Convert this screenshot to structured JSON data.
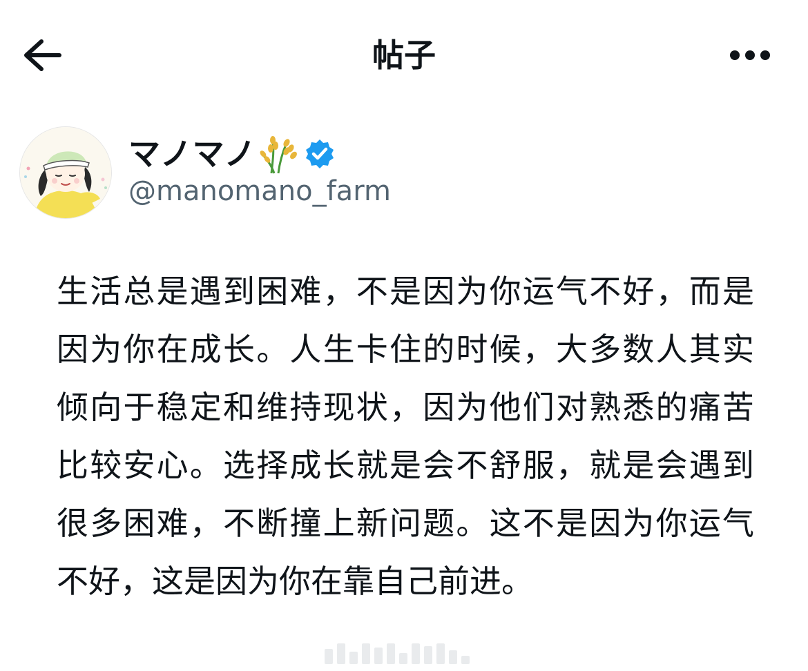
{
  "header": {
    "title": "帖子",
    "back_icon": "arrow-left-icon",
    "more_icon": "more-horizontal-icon"
  },
  "author": {
    "display_name": "マノマノ",
    "handle": "@manomano_farm",
    "name_emoji": "rice-icon",
    "verified": true,
    "verified_color": "#1d9bf0"
  },
  "post": {
    "text": "生活总是遇到困难，不是因为你运气不好，而是因为你在成长。人生卡住的时候，大多数人其实倾向于稳定和维持现状，因为他们对熟悉的痛苦比较安心。选择成长就是会不舒服，就是会遇到很多困难，不断撞上新问题。这不是因为你运气不好，这是因为你在靠自己前进。"
  },
  "colors": {
    "text_primary": "#0f1419",
    "text_secondary": "#536471",
    "background": "#ffffff"
  }
}
